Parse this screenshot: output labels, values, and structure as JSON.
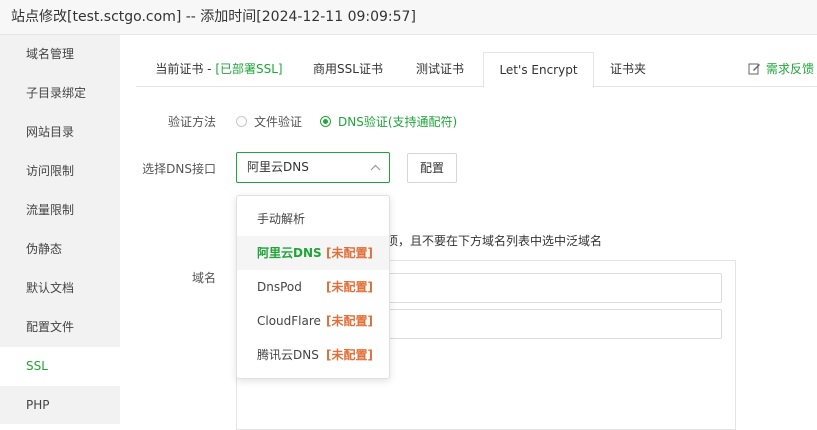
{
  "window": {
    "title": "站点修改[test.sctgo.com] -- 添加时间[2024-12-11 09:09:57]"
  },
  "sidebar": {
    "items": [
      {
        "label": "域名管理"
      },
      {
        "label": "子目录绑定"
      },
      {
        "label": "网站目录"
      },
      {
        "label": "访问限制"
      },
      {
        "label": "流量限制"
      },
      {
        "label": "伪静态"
      },
      {
        "label": "默认文档"
      },
      {
        "label": "配置文件"
      },
      {
        "label": "SSL"
      },
      {
        "label": "PHP"
      }
    ],
    "active_index": 8
  },
  "tabs": {
    "current_prefix": "当前证书 - ",
    "current_status": "[已部署SSL]",
    "commercial": "商用SSL证书",
    "test": "测试证书",
    "letsencrypt": "Let's Encrypt",
    "folder": "证书夹",
    "active": "Let's Encrypt"
  },
  "feedback": {
    "label": "需求反馈"
  },
  "form": {
    "verify_label": "验证方法",
    "verify_options": [
      "文件验证",
      "DNS验证(支持通配符)"
    ],
    "verify_selected": "DNS验证(支持通配符)",
    "dns_label": "选择DNS接口",
    "dns_selected": "阿里云DNS",
    "config_button": "配置",
    "note": "此项，且不要在下方域名列表中选中泛域名",
    "domain_label": "域名"
  },
  "dropdown": {
    "options": [
      {
        "label": "手动解析",
        "tag": ""
      },
      {
        "label": "阿里云DNS",
        "tag": "[未配置]"
      },
      {
        "label": "DnsPod",
        "tag": "[未配置]"
      },
      {
        "label": "CloudFlare",
        "tag": "[未配置]"
      },
      {
        "label": "腾讯云DNS",
        "tag": "[未配置]"
      }
    ],
    "selected": "阿里云DNS"
  },
  "colors": {
    "accent": "#20a53a",
    "warning": "#e0703a"
  }
}
